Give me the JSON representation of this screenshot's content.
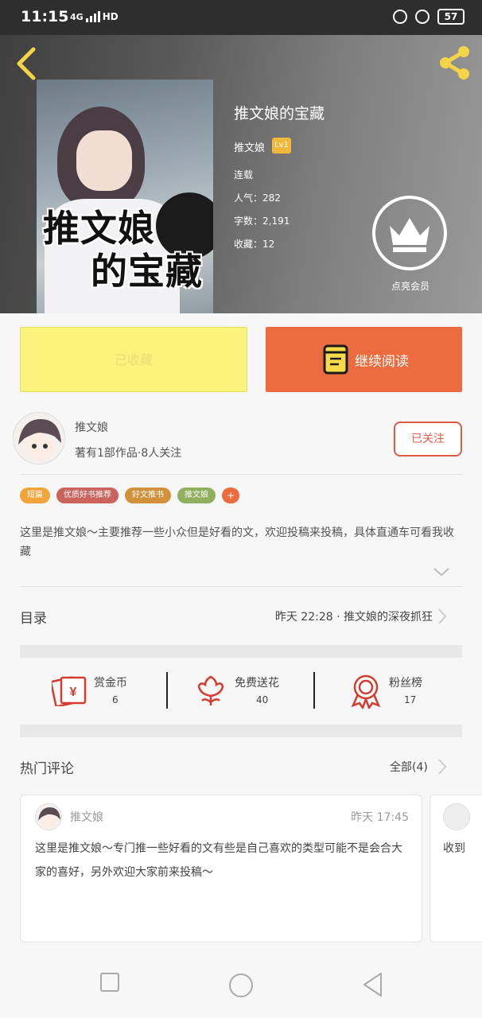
{
  "status_bar": {
    "time": "11:15",
    "network": "4G",
    "hd": "HD",
    "battery": "57"
  },
  "book": {
    "title": "推文娘的宝藏",
    "author": "推文娘",
    "level": "Lv1",
    "status": "连载",
    "popularity": "人气：282",
    "word_count": "字数：2,191",
    "collections": "收藏：12",
    "cover_title_line1": "推文娘",
    "cover_title_line2": "的宝藏"
  },
  "member": {
    "label": "点亮会员"
  },
  "actions": {
    "collected_label": "已收藏",
    "continue_label": "继续阅读"
  },
  "author_card": {
    "name": "推文娘",
    "stats": "著有1部作品·8人关注",
    "follow_label": "已关注"
  },
  "tags": [
    {
      "label": "短篇",
      "color": "#f2a33a"
    },
    {
      "label": "优质好书推荐",
      "color": "#c9635c"
    },
    {
      "label": "好文推书",
      "color": "#d0913a"
    },
    {
      "label": "推文娘",
      "color": "#8fb05f"
    },
    {
      "label": "+",
      "color": "#ec6c3f"
    }
  ],
  "intro": "这里是推文娘～主要推荐一些小众但是好看的文，欢迎投稿来投稿，具体直通车可看我收藏",
  "catalog": {
    "label": "目录",
    "latest": "昨天 22:28 · 推文娘的深夜抓狂"
  },
  "stats": [
    {
      "label": "赏金币",
      "value": "6",
      "icon": "reward-coin-icon"
    },
    {
      "label": "免费送花",
      "value": "40",
      "icon": "flower-icon"
    },
    {
      "label": "粉丝榜",
      "value": "17",
      "icon": "medal-icon"
    }
  ],
  "comments_section": {
    "title": "热门评论",
    "all_label": "全部(4)",
    "comments": [
      {
        "author": "推文娘",
        "time": "昨天 17:45",
        "text": "这里是推文娘～专门推一些好看的文有些是自己喜欢的类型可能不是会合大家的喜好，另外欢迎大家前来投稿～"
      },
      {
        "text": "收到"
      }
    ]
  },
  "colors": {
    "accent_orange": "#ec6c3f",
    "collected_yellow": "#fbf37c",
    "follow_red": "#e25a46",
    "share_yellow": "#f5d547"
  }
}
